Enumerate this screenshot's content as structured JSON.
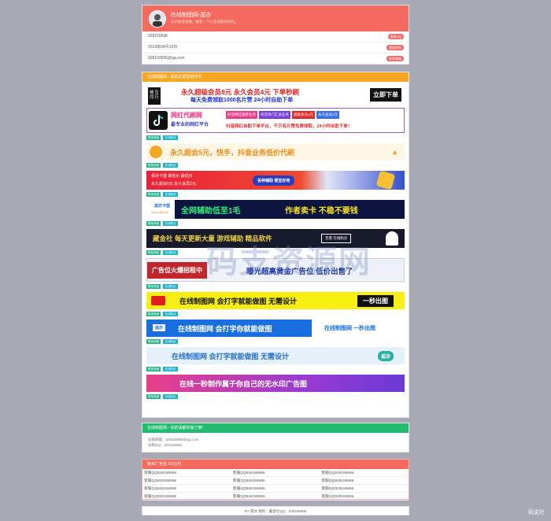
{
  "profile": {
    "title": "在线制图网-孤亦",
    "subtitle": "认识就会有缘，能在一个心生就能好好吗。",
    "rows": [
      {
        "text": "928159596",
        "btn": "联系QQ"
      },
      {
        "text": "2019年04月16日",
        "btn": "建站时间"
      },
      {
        "text": "928159596@qq.com",
        "btn": "联系邮箱"
      }
    ]
  },
  "ads": {
    "header": "在线制图网 - 最低价帮您制作中",
    "tag_contact": "联系商家",
    "tag_visit": "在线购买",
    "b1": {
      "left": "畅 压 同 行",
      "line1": "永久超级会员8元  永久会员4元  下单秒刷",
      "line2": "每天免费领取1000名片赞  24小时自助下单",
      "btn": "立即下单"
    },
    "b2": {
      "name": "网红代刷网",
      "sub": "最专业的网红平台",
      "tags": [
        "抖音网红推荐业务",
        "抖音热门汇总业务",
        "超级会员4元",
        "永久会员2元"
      ],
      "line": "抖音网红自助下单平台，千万名片赞免费领取，24小时自助下单！"
    },
    "b3": {
      "text": "永久超会5元，快手，抖音业务低价代刷"
    },
    "b4": {
      "l1": "佰亦卡盟 最低价 最低价",
      "l2": "永久超会5元 永久会员2元",
      "btn": "各种辅助 便宜好用"
    },
    "b5": {
      "logo": "孤亦卡盟",
      "site": "www.qiiia.cn",
      "text": "全网辅助低至1毛",
      "text2": "作者卖卡  不稳不要钱"
    },
    "b6": {
      "text": "藏金社 每天更新大量 游戏辅助 精品软件",
      "right": "无需 在线购买"
    },
    "b7": {
      "left": "广告位火爆招租中",
      "right": "曝光超高黄金广告位 低价出售了"
    },
    "b8": {
      "text": "在线制图网  会打字就能做图  无需设计",
      "btn": "一秒出图"
    },
    "b9": {
      "logo": "孤亦",
      "text": "在线制图网  会打字你就能做图",
      "right": "在线制图网  一秒出图"
    },
    "b10": {
      "text": "在线制图网  会打字就能做图 无需设计",
      "logo": "孤亦"
    },
    "b11": {
      "text": "在线一秒制作属于你自己的无水印广告图"
    }
  },
  "contact": {
    "header": "在线制图网 - 好的请都你做了算！",
    "email": "投稿邮箱：928159596@qq.com",
    "qq": "投稿QQ：928159596"
  },
  "rental": {
    "header": "购买广告位 15元/月",
    "cells": [
      "客服QQ928159596",
      "客服QQ928159596",
      "客服QQ928159596",
      "客服QQ928159596",
      "客服QQ928159596",
      "客服QQ928159596",
      "客服QQ928159596",
      "客服QQ928159596",
      "客服QQ928159596",
      "客服QQ928159596",
      "客服QQ928159596",
      "客服QQ928159596"
    ]
  },
  "footer": {
    "text": "BY 孤亦 授权：藏金社QQ：928159596"
  },
  "watermark": {
    "text": "码支资源网",
    "corner": "码支社"
  }
}
